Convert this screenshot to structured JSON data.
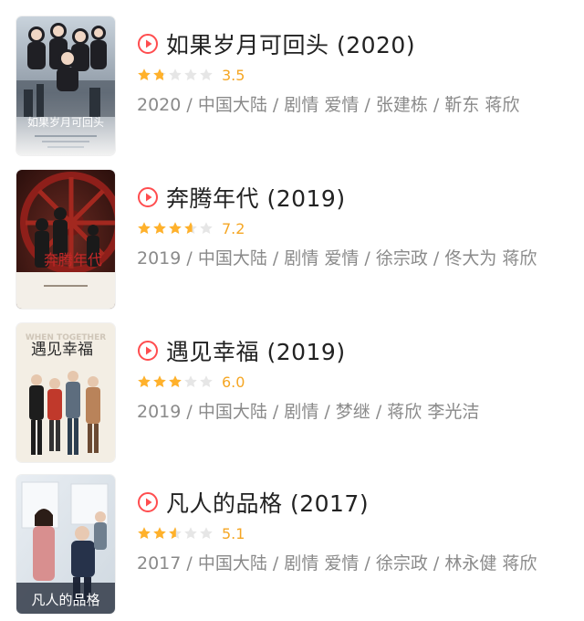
{
  "colors": {
    "accent": "#ff4d4f",
    "star_on": "#ffb12b",
    "star_off": "#e6e6e6",
    "score": "#f5a623",
    "meta": "#8a8a8a"
  },
  "movies": [
    {
      "title": "如果岁月可回头 (2020)",
      "score": "3.5",
      "stars": 1.75,
      "meta": "2020 / 中国大陆 / 剧情 爱情 / 张建栋 / 靳东 蒋欣",
      "poster_text": "如果岁月可回头",
      "poster_icon": "poster-image"
    },
    {
      "title": "奔腾年代 (2019)",
      "score": "7.2",
      "stars": 3.6,
      "meta": "2019 / 中国大陆 / 剧情 爱情 / 徐宗政 / 佟大为 蒋欣",
      "poster_text": "奔腾年代",
      "poster_icon": "poster-image"
    },
    {
      "title": "遇见幸福 (2019)",
      "score": "6.0",
      "stars": 3.0,
      "meta": "2019 / 中国大陆 / 剧情 / 梦继 / 蒋欣 李光洁",
      "poster_text": "遇见幸福",
      "poster_text_en": "WHEN TOGETHER",
      "poster_icon": "poster-image"
    },
    {
      "title": "凡人的品格 (2017)",
      "score": "5.1",
      "stars": 2.55,
      "meta": "2017 / 中国大陆 / 剧情 爱情 / 徐宗政 / 林永健 蒋欣",
      "poster_text": "凡人的品格",
      "poster_icon": "poster-image"
    }
  ]
}
